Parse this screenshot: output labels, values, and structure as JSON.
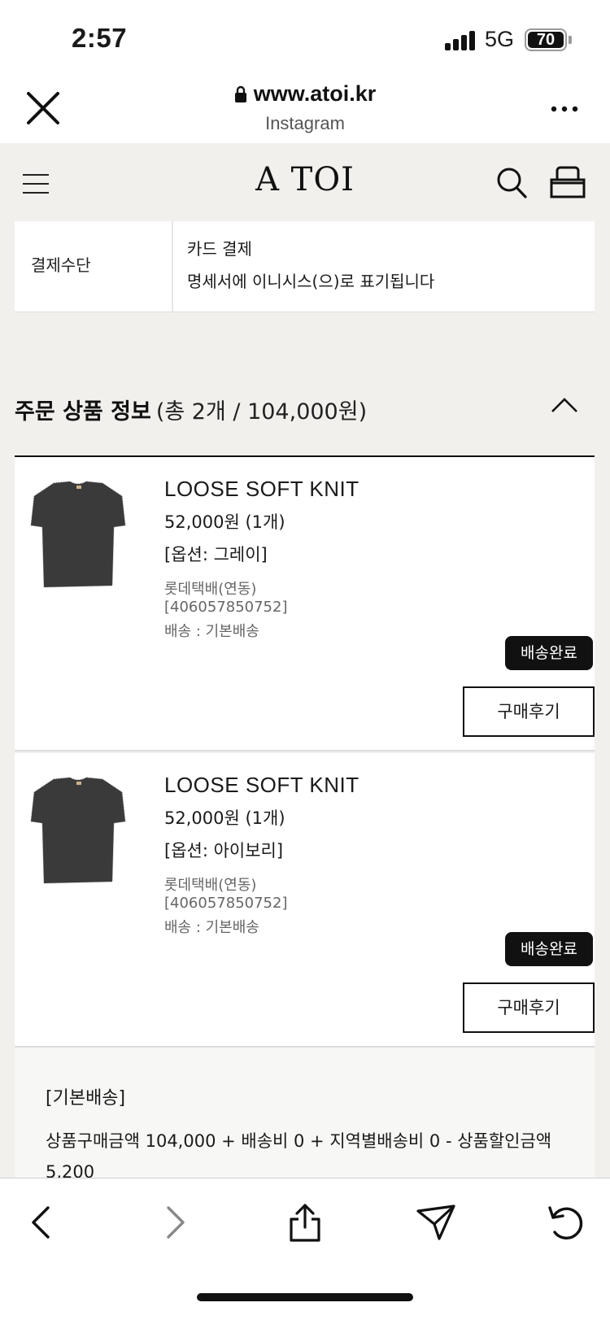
{
  "status": {
    "time": "2:57",
    "network": "5G",
    "battery": "70"
  },
  "browser": {
    "url": "www.atoi.kr",
    "source": "Instagram"
  },
  "site": {
    "logo": "A TOI"
  },
  "payment": {
    "label": "결제수단",
    "method": "카드 결제",
    "note": "명세서에 이니시스(으)로 표기됩니다"
  },
  "order": {
    "title": "주문 상품 정보",
    "summary": "(총 2개 / 104,000원)"
  },
  "products": [
    {
      "name": "LOOSE SOFT KNIT",
      "price": "52,000원 (1개)",
      "option": "[옵션: 그레이]",
      "courier": "롯데택배(연동)",
      "tracking": "[406057850752]",
      "delivery": "배송 : 기본배송",
      "status": "배송완료",
      "review_label": "구매후기"
    },
    {
      "name": "LOOSE SOFT KNIT",
      "price": "52,000원 (1개)",
      "option": "[옵션: 아이보리]",
      "courier": "롯데택배(연동)",
      "tracking": "[406057850752]",
      "delivery": "배송 : 기본배송",
      "status": "배송완료",
      "review_label": "구매후기"
    }
  ],
  "shipping": {
    "title": "[기본배송]",
    "calc": "상품구매금액 104,000 + 배송비 0 + 지역별배송비 0 - 상품할인금액 5,200"
  },
  "colors": {
    "page_bg": "#f1f0ec",
    "badge_bg": "#111111",
    "text": "#1a1a1a"
  }
}
